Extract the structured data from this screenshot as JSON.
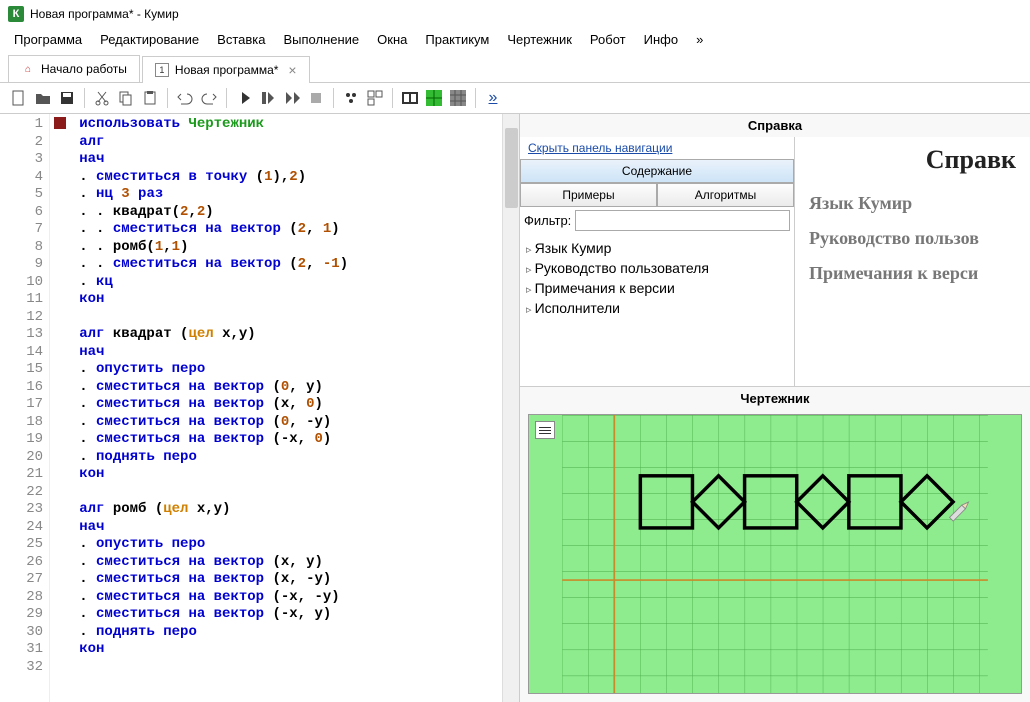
{
  "window": {
    "title": "Новая программа* - Кумир",
    "icon_letter": "К"
  },
  "menu": [
    "Программа",
    "Редактирование",
    "Вставка",
    "Выполнение",
    "Окна",
    "Практикум",
    "Чертежник",
    "Робот",
    "Инфо",
    "»"
  ],
  "tabs": [
    {
      "label": "Начало работы",
      "active": false,
      "closable": false
    },
    {
      "label": "Новая программа*",
      "active": true,
      "closable": true
    }
  ],
  "code_lines": 32,
  "code_tokens": [
    [
      [
        "kw",
        "использовать "
      ],
      [
        "exec",
        "Чертежник"
      ]
    ],
    [
      [
        "kw",
        "алг"
      ]
    ],
    [
      [
        "kw",
        "нач"
      ]
    ],
    [
      [
        "black",
        ". "
      ],
      [
        "kw",
        "сместиться в точку "
      ],
      [
        "black",
        "("
      ],
      [
        "num",
        "1"
      ],
      [
        "black",
        "),"
      ],
      [
        "num",
        "2"
      ],
      [
        "black",
        ")"
      ]
    ],
    [
      [
        "black",
        ". "
      ],
      [
        "kw",
        "нц "
      ],
      [
        "num",
        "3"
      ],
      [
        "kw",
        " раз"
      ]
    ],
    [
      [
        "black",
        ". . "
      ],
      [
        "black",
        "квадрат("
      ],
      [
        "num",
        "2"
      ],
      [
        "black",
        ","
      ],
      [
        "num",
        "2"
      ],
      [
        "black",
        ")"
      ]
    ],
    [
      [
        "black",
        ". . "
      ],
      [
        "kw",
        "сместиться на вектор "
      ],
      [
        "black",
        "("
      ],
      [
        "num",
        "2"
      ],
      [
        "black",
        ", "
      ],
      [
        "num",
        "1"
      ],
      [
        "black",
        ")"
      ]
    ],
    [
      [
        "black",
        ". . "
      ],
      [
        "black",
        "ромб("
      ],
      [
        "num",
        "1"
      ],
      [
        "black",
        ","
      ],
      [
        "num",
        "1"
      ],
      [
        "black",
        ")"
      ]
    ],
    [
      [
        "black",
        ". . "
      ],
      [
        "kw",
        "сместиться на вектор "
      ],
      [
        "black",
        "("
      ],
      [
        "num",
        "2"
      ],
      [
        "black",
        ", "
      ],
      [
        "num",
        "-1"
      ],
      [
        "black",
        ")"
      ]
    ],
    [
      [
        "black",
        ". "
      ],
      [
        "kw",
        "кц"
      ]
    ],
    [
      [
        "kw",
        "кон"
      ]
    ],
    [],
    [
      [
        "kw",
        "алг "
      ],
      [
        "black",
        "квадрат ("
      ],
      [
        "type",
        "цел "
      ],
      [
        "black",
        "x,y)"
      ]
    ],
    [
      [
        "kw",
        "нач"
      ]
    ],
    [
      [
        "black",
        ". "
      ],
      [
        "kw",
        "опустить перо"
      ]
    ],
    [
      [
        "black",
        ". "
      ],
      [
        "kw",
        "сместиться на вектор "
      ],
      [
        "black",
        "("
      ],
      [
        "num",
        "0"
      ],
      [
        "black",
        ", y)"
      ]
    ],
    [
      [
        "black",
        ". "
      ],
      [
        "kw",
        "сместиться на вектор "
      ],
      [
        "black",
        "(x, "
      ],
      [
        "num",
        "0"
      ],
      [
        "black",
        ")"
      ]
    ],
    [
      [
        "black",
        ". "
      ],
      [
        "kw",
        "сместиться на вектор "
      ],
      [
        "black",
        "("
      ],
      [
        "num",
        "0"
      ],
      [
        "black",
        ", -y)"
      ]
    ],
    [
      [
        "black",
        ". "
      ],
      [
        "kw",
        "сместиться на вектор "
      ],
      [
        "black",
        "(-x, "
      ],
      [
        "num",
        "0"
      ],
      [
        "black",
        ")"
      ]
    ],
    [
      [
        "black",
        ". "
      ],
      [
        "kw",
        "поднять перо"
      ]
    ],
    [
      [
        "kw",
        "кон"
      ]
    ],
    [],
    [
      [
        "kw",
        "алг "
      ],
      [
        "black",
        "ромб ("
      ],
      [
        "type",
        "цел "
      ],
      [
        "black",
        "x,y)"
      ]
    ],
    [
      [
        "kw",
        "нач"
      ]
    ],
    [
      [
        "black",
        ". "
      ],
      [
        "kw",
        "опустить перо"
      ]
    ],
    [
      [
        "black",
        ". "
      ],
      [
        "kw",
        "сместиться на вектор "
      ],
      [
        "black",
        "(x, y)"
      ]
    ],
    [
      [
        "black",
        ". "
      ],
      [
        "kw",
        "сместиться на вектор "
      ],
      [
        "black",
        "(x, -y)"
      ]
    ],
    [
      [
        "black",
        ". "
      ],
      [
        "kw",
        "сместиться на вектор "
      ],
      [
        "black",
        "(-x, -y)"
      ]
    ],
    [
      [
        "black",
        ". "
      ],
      [
        "kw",
        "сместиться на вектор "
      ],
      [
        "black",
        "(-x, y)"
      ]
    ],
    [
      [
        "black",
        ". "
      ],
      [
        "kw",
        "поднять перо"
      ]
    ],
    [
      [
        "kw",
        "кон"
      ]
    ],
    []
  ],
  "help": {
    "panel_title": "Справка",
    "hide_nav": "Скрыть панель навигации",
    "nav_tabs": [
      "Содержание",
      "Примеры",
      "Алгоритмы"
    ],
    "filter_label": "Фильтр:",
    "tree": [
      "Язык Кумир",
      "Руководство пользователя",
      "Примечания к версии",
      "Исполнители"
    ],
    "heading": "Справк",
    "links": [
      "Язык Кумир",
      "Руководство пользов",
      "Примечания к верси"
    ]
  },
  "drawer": {
    "title": "Чертежник"
  }
}
